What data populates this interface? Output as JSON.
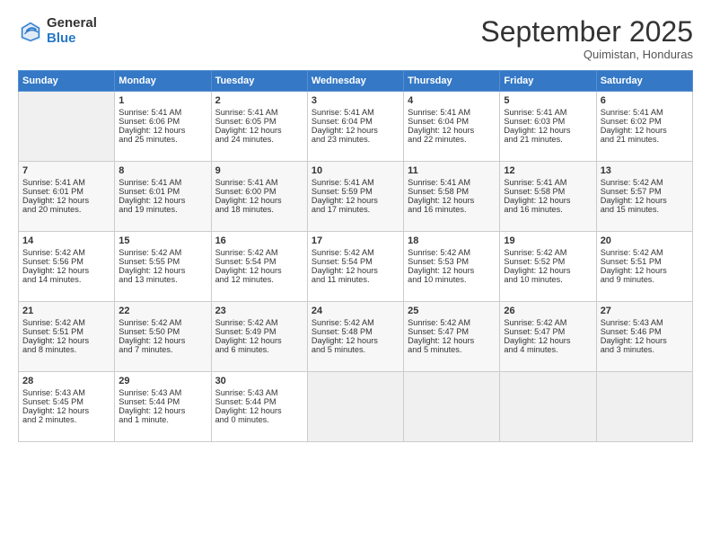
{
  "logo": {
    "general": "General",
    "blue": "Blue"
  },
  "header": {
    "month": "September 2025",
    "location": "Quimistan, Honduras"
  },
  "days_of_week": [
    "Sunday",
    "Monday",
    "Tuesday",
    "Wednesday",
    "Thursday",
    "Friday",
    "Saturday"
  ],
  "weeks": [
    [
      {
        "day": "",
        "content": ""
      },
      {
        "day": "1",
        "content": "Sunrise: 5:41 AM\nSunset: 6:06 PM\nDaylight: 12 hours\nand 25 minutes."
      },
      {
        "day": "2",
        "content": "Sunrise: 5:41 AM\nSunset: 6:05 PM\nDaylight: 12 hours\nand 24 minutes."
      },
      {
        "day": "3",
        "content": "Sunrise: 5:41 AM\nSunset: 6:04 PM\nDaylight: 12 hours\nand 23 minutes."
      },
      {
        "day": "4",
        "content": "Sunrise: 5:41 AM\nSunset: 6:04 PM\nDaylight: 12 hours\nand 22 minutes."
      },
      {
        "day": "5",
        "content": "Sunrise: 5:41 AM\nSunset: 6:03 PM\nDaylight: 12 hours\nand 21 minutes."
      },
      {
        "day": "6",
        "content": "Sunrise: 5:41 AM\nSunset: 6:02 PM\nDaylight: 12 hours\nand 21 minutes."
      }
    ],
    [
      {
        "day": "7",
        "content": "Sunrise: 5:41 AM\nSunset: 6:01 PM\nDaylight: 12 hours\nand 20 minutes."
      },
      {
        "day": "8",
        "content": "Sunrise: 5:41 AM\nSunset: 6:01 PM\nDaylight: 12 hours\nand 19 minutes."
      },
      {
        "day": "9",
        "content": "Sunrise: 5:41 AM\nSunset: 6:00 PM\nDaylight: 12 hours\nand 18 minutes."
      },
      {
        "day": "10",
        "content": "Sunrise: 5:41 AM\nSunset: 5:59 PM\nDaylight: 12 hours\nand 17 minutes."
      },
      {
        "day": "11",
        "content": "Sunrise: 5:41 AM\nSunset: 5:58 PM\nDaylight: 12 hours\nand 16 minutes."
      },
      {
        "day": "12",
        "content": "Sunrise: 5:41 AM\nSunset: 5:58 PM\nDaylight: 12 hours\nand 16 minutes."
      },
      {
        "day": "13",
        "content": "Sunrise: 5:42 AM\nSunset: 5:57 PM\nDaylight: 12 hours\nand 15 minutes."
      }
    ],
    [
      {
        "day": "14",
        "content": "Sunrise: 5:42 AM\nSunset: 5:56 PM\nDaylight: 12 hours\nand 14 minutes."
      },
      {
        "day": "15",
        "content": "Sunrise: 5:42 AM\nSunset: 5:55 PM\nDaylight: 12 hours\nand 13 minutes."
      },
      {
        "day": "16",
        "content": "Sunrise: 5:42 AM\nSunset: 5:54 PM\nDaylight: 12 hours\nand 12 minutes."
      },
      {
        "day": "17",
        "content": "Sunrise: 5:42 AM\nSunset: 5:54 PM\nDaylight: 12 hours\nand 11 minutes."
      },
      {
        "day": "18",
        "content": "Sunrise: 5:42 AM\nSunset: 5:53 PM\nDaylight: 12 hours\nand 10 minutes."
      },
      {
        "day": "19",
        "content": "Sunrise: 5:42 AM\nSunset: 5:52 PM\nDaylight: 12 hours\nand 10 minutes."
      },
      {
        "day": "20",
        "content": "Sunrise: 5:42 AM\nSunset: 5:51 PM\nDaylight: 12 hours\nand 9 minutes."
      }
    ],
    [
      {
        "day": "21",
        "content": "Sunrise: 5:42 AM\nSunset: 5:51 PM\nDaylight: 12 hours\nand 8 minutes."
      },
      {
        "day": "22",
        "content": "Sunrise: 5:42 AM\nSunset: 5:50 PM\nDaylight: 12 hours\nand 7 minutes."
      },
      {
        "day": "23",
        "content": "Sunrise: 5:42 AM\nSunset: 5:49 PM\nDaylight: 12 hours\nand 6 minutes."
      },
      {
        "day": "24",
        "content": "Sunrise: 5:42 AM\nSunset: 5:48 PM\nDaylight: 12 hours\nand 5 minutes."
      },
      {
        "day": "25",
        "content": "Sunrise: 5:42 AM\nSunset: 5:47 PM\nDaylight: 12 hours\nand 5 minutes."
      },
      {
        "day": "26",
        "content": "Sunrise: 5:42 AM\nSunset: 5:47 PM\nDaylight: 12 hours\nand 4 minutes."
      },
      {
        "day": "27",
        "content": "Sunrise: 5:43 AM\nSunset: 5:46 PM\nDaylight: 12 hours\nand 3 minutes."
      }
    ],
    [
      {
        "day": "28",
        "content": "Sunrise: 5:43 AM\nSunset: 5:45 PM\nDaylight: 12 hours\nand 2 minutes."
      },
      {
        "day": "29",
        "content": "Sunrise: 5:43 AM\nSunset: 5:44 PM\nDaylight: 12 hours\nand 1 minute."
      },
      {
        "day": "30",
        "content": "Sunrise: 5:43 AM\nSunset: 5:44 PM\nDaylight: 12 hours\nand 0 minutes."
      },
      {
        "day": "",
        "content": ""
      },
      {
        "day": "",
        "content": ""
      },
      {
        "day": "",
        "content": ""
      },
      {
        "day": "",
        "content": ""
      }
    ]
  ]
}
